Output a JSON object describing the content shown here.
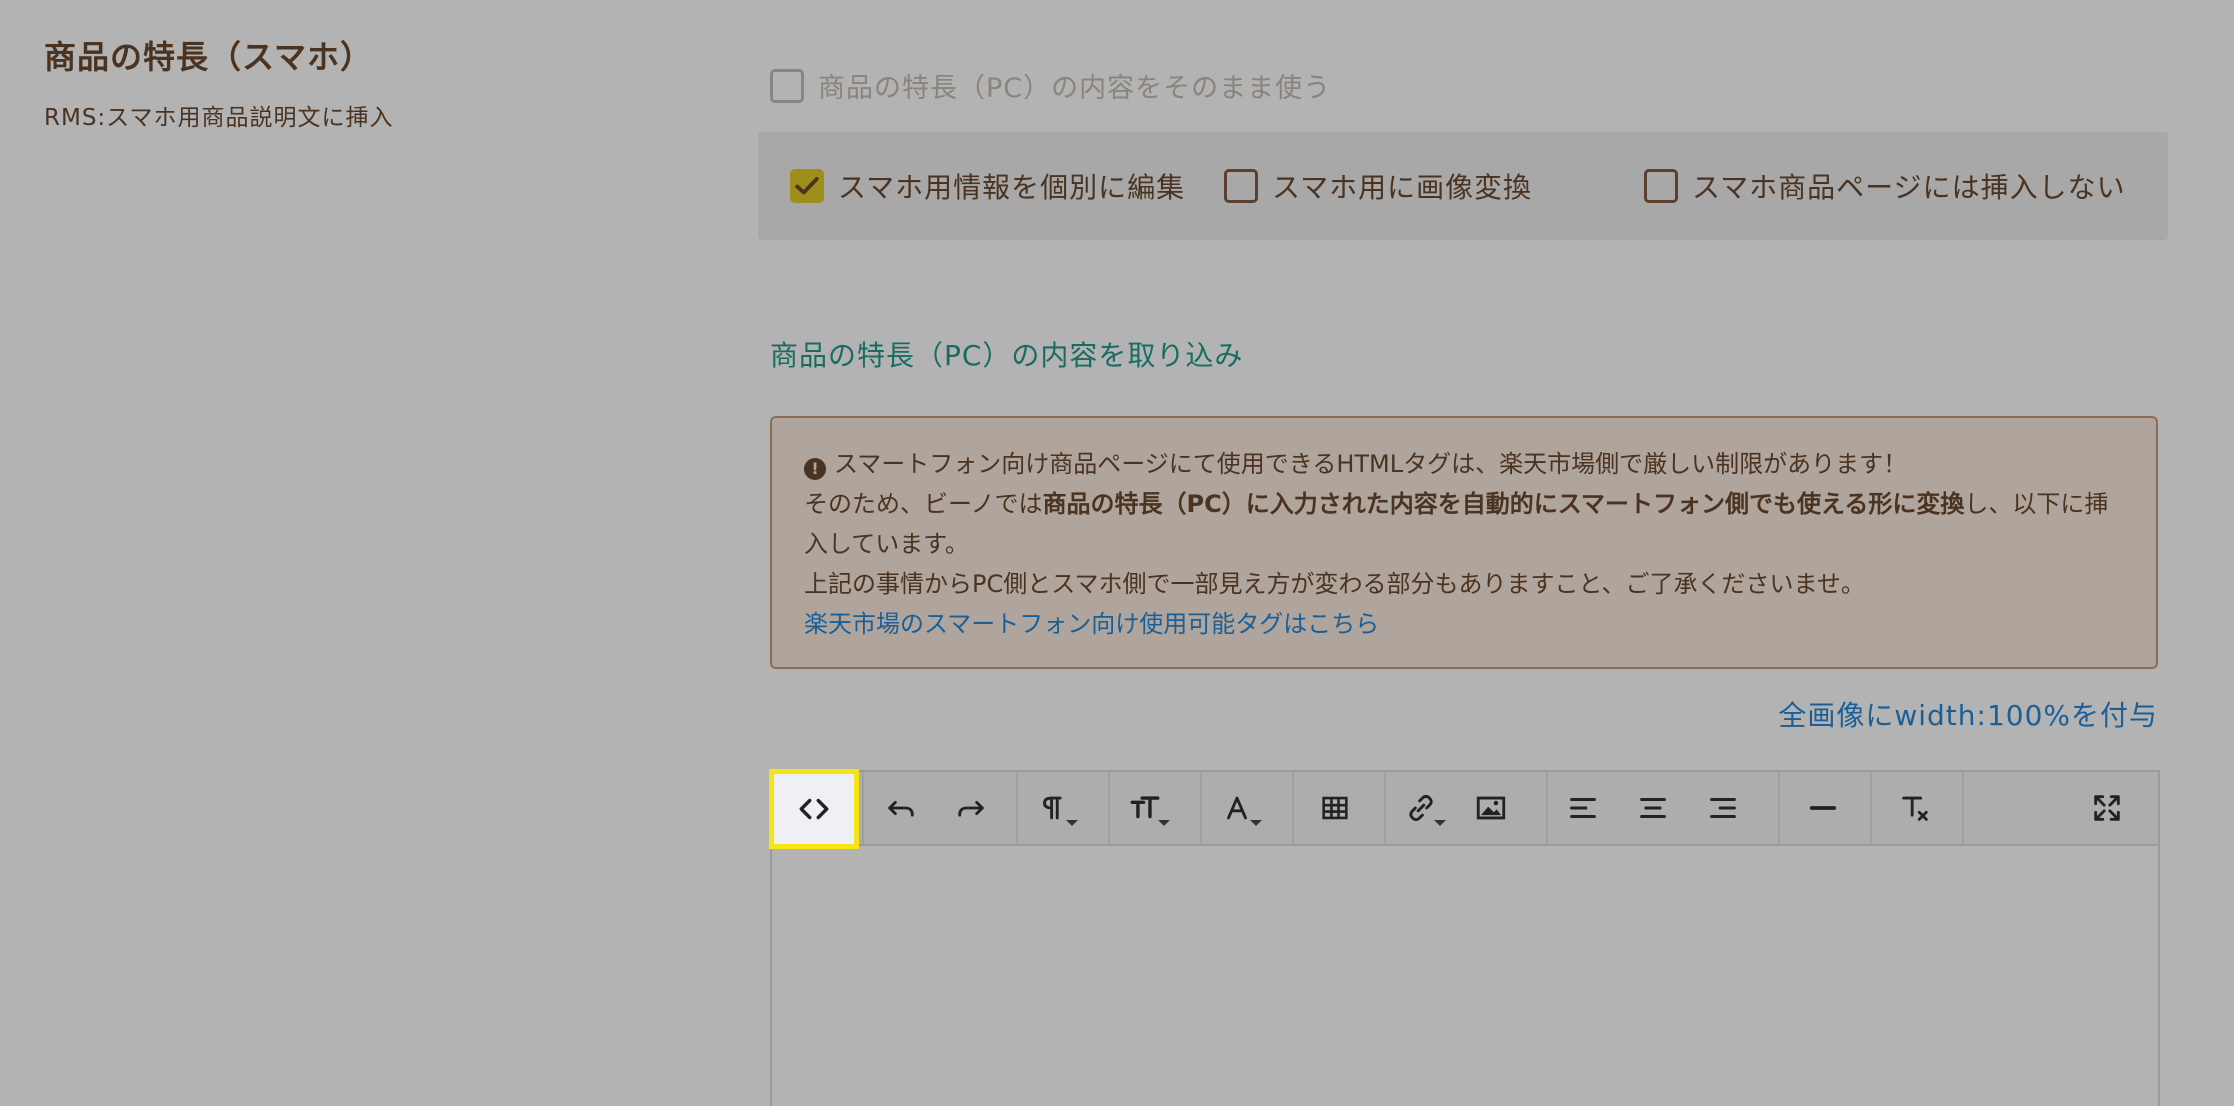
{
  "section": {
    "title": "商品の特長（スマホ）",
    "subtitle": "RMS:スマホ用商品説明文に挿入"
  },
  "options": {
    "use_pc_content": {
      "label": "商品の特長（PC）の内容をそのまま使う",
      "checked": false
    },
    "edit_individually": {
      "label": "スマホ用情報を個別に編集",
      "checked": true
    },
    "convert_images": {
      "label": "スマホ用に画像変換",
      "checked": false
    },
    "do_not_insert": {
      "label": "スマホ商品ページには挿入しない",
      "checked": false
    }
  },
  "import_link": "商品の特長（PC）の内容を取り込み",
  "notice": {
    "line1": "スマートフォン向け商品ページにて使用できるHTMLタグは、楽天市場側で厳しい制限があります！",
    "line2_pre": "そのため、ビーノでは",
    "line2_bold": "商品の特長（PC）に入力された内容を自動的にスマートフォン側でも使える形に変換",
    "line2_post": "し、以下に挿入しています。",
    "line3": "上記の事情からPC側とスマホ側で一部見え方が変わる部分もありますこと、ご了承くださいませ。",
    "tag_link": "楽天市場のスマートフォン向け使用可能タグはこちら"
  },
  "width_link": "全画像にwidth:100%を付与",
  "toolbar": {
    "buttons": [
      "code-view",
      "undo",
      "redo",
      "paragraph",
      "font-size",
      "font-color",
      "table",
      "link",
      "image",
      "align-left",
      "align-center",
      "align-right",
      "horizontal-rule",
      "clear-format",
      "fullscreen"
    ],
    "highlighted": "code-view"
  },
  "colors": {
    "overlay_bg": "#b3b3b3",
    "check_accent": "#9f8f1a",
    "link_teal": "#176d62",
    "link_blue": "#1a5f98",
    "highlight": "#f6e514"
  }
}
